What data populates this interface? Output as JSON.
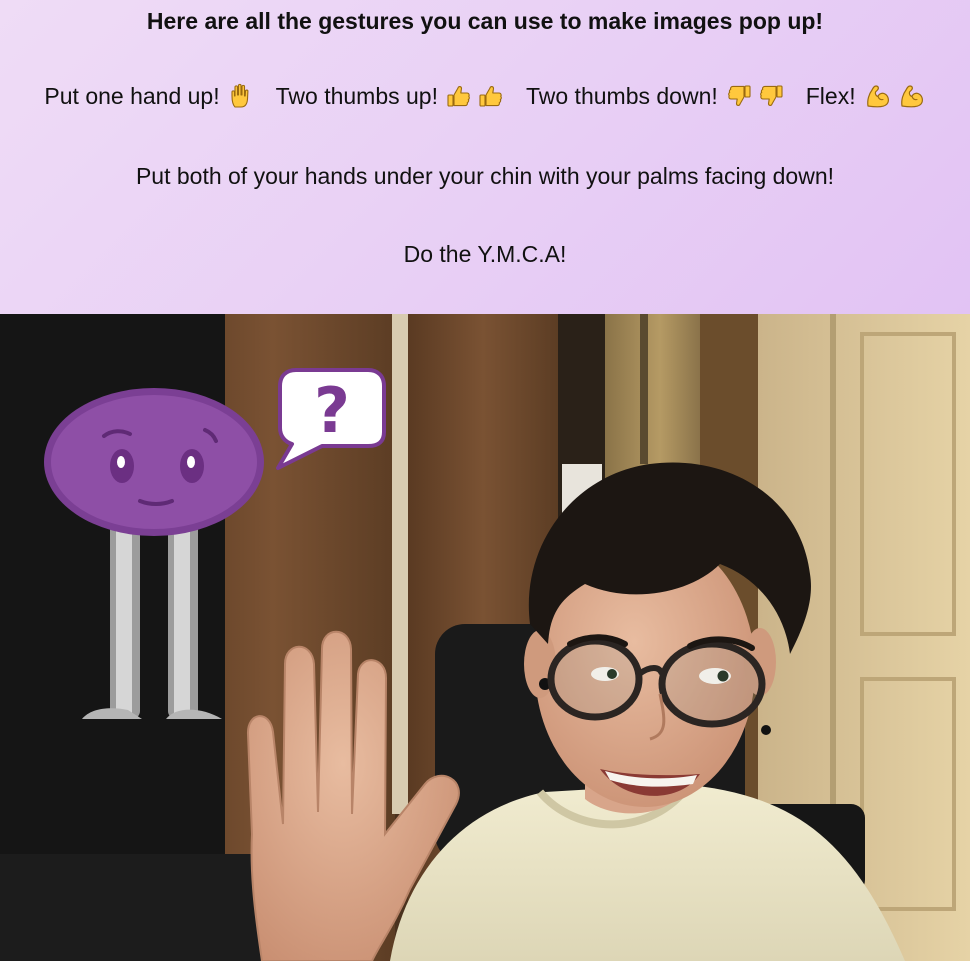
{
  "instructions": {
    "heading": "Here are all the gestures you can use to make images pop up!",
    "gestures": [
      {
        "label": "Put one hand up!",
        "icons": [
          "raised-hand-icon"
        ]
      },
      {
        "label": "Two thumbs up!",
        "icons": [
          "thumbs-up-icon",
          "thumbs-up-icon"
        ]
      },
      {
        "label": "Two thumbs down!",
        "icons": [
          "thumbs-down-icon",
          "thumbs-down-icon"
        ]
      },
      {
        "label": "Flex!",
        "icons": [
          "flexed-biceps-icon",
          "flexed-biceps-icon"
        ]
      }
    ],
    "chin_instruction": "Put both of your hands under your chin with your palms facing down!",
    "ymca_instruction": "Do the Y.M.C.A!"
  },
  "colors": {
    "banner_background": "#e8cff5",
    "emoji_yellow": "#ffc83d",
    "character_purple": "#8e4fa6",
    "speech_bubble_outline": "#7a3a92"
  },
  "camera_overlay": {
    "character": "purple-blob-character",
    "speech_bubble_symbol": "?"
  }
}
